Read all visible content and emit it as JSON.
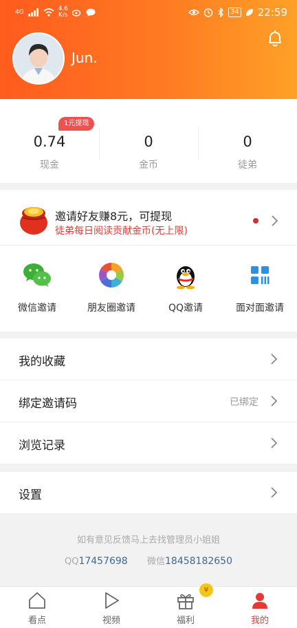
{
  "status_bar": {
    "signal_label": "4G",
    "net_speed_value": "4.6",
    "net_speed_unit": "K/s",
    "battery": "34",
    "time": "22:59"
  },
  "profile": {
    "username": "Jun."
  },
  "stats": {
    "withdraw_tag": "1元提现",
    "items": [
      {
        "value": "0.74",
        "label": "现金"
      },
      {
        "value": "0",
        "label": "金币"
      },
      {
        "value": "0",
        "label": "徒弟"
      }
    ]
  },
  "invite": {
    "title": "邀请好友赚8元，可提现",
    "subtitle": "徒弟每日阅读贡献金币(无上限)",
    "shares": [
      {
        "label": "微信邀请",
        "icon": "wechat-icon"
      },
      {
        "label": "朋友圈邀请",
        "icon": "moments-icon"
      },
      {
        "label": "QQ邀请",
        "icon": "qq-icon"
      },
      {
        "label": "面对面邀请",
        "icon": "qrcode-icon"
      }
    ]
  },
  "menu": {
    "items": [
      {
        "label": "我的收藏",
        "extra": ""
      },
      {
        "label": "绑定邀请码",
        "extra": "已绑定"
      },
      {
        "label": "浏览记录",
        "extra": ""
      }
    ],
    "settings": "设置"
  },
  "feedback": {
    "line1": "如有意见反馈马上去找管理员小姐姐",
    "qq_label": "QQ",
    "qq_number": "17457698",
    "wechat_label": "微信",
    "wechat_number": "18458182650"
  },
  "tabbar": {
    "coin_badge": "¥",
    "items": [
      {
        "label": "看点",
        "icon": "home-icon"
      },
      {
        "label": "视频",
        "icon": "play-icon"
      },
      {
        "label": "福利",
        "icon": "gift-icon"
      },
      {
        "label": "我的",
        "icon": "user-icon"
      }
    ],
    "active": "我的"
  },
  "colors": {
    "brand_orange": "#ff6a20",
    "accent_red": "#e53935",
    "link_blue": "#3f6890"
  }
}
